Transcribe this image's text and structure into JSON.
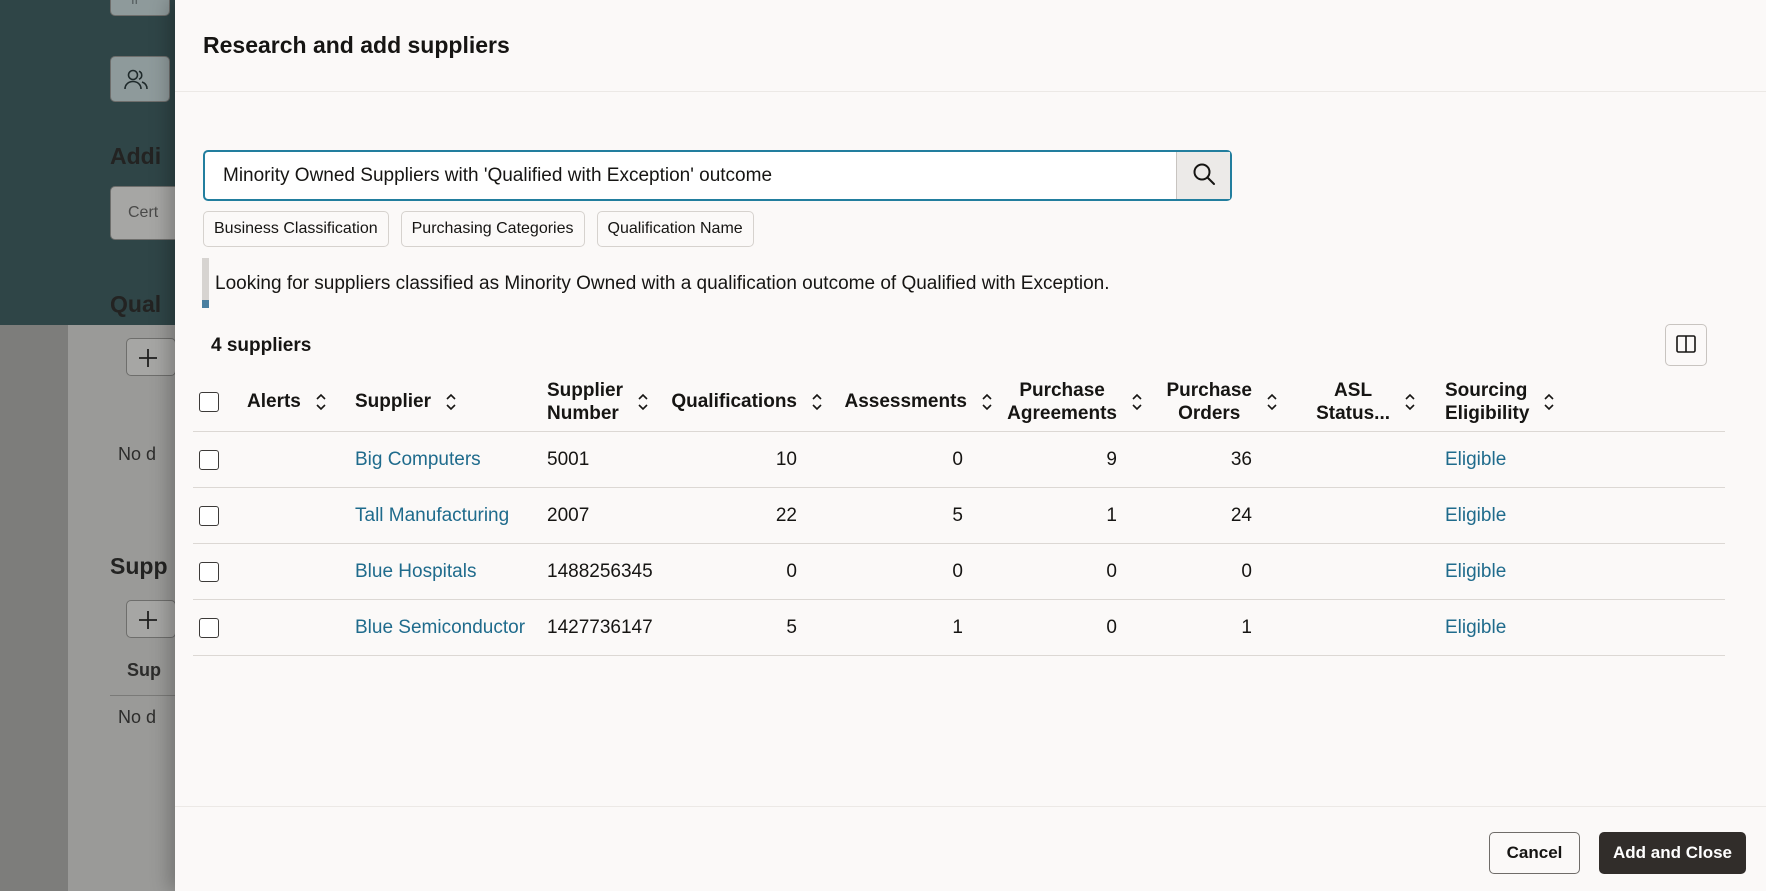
{
  "background": {
    "section_additional": "Addi",
    "field_cert": "Cert",
    "section_qual": "Qual",
    "no_data_1": "No d",
    "section_supp": "Supp",
    "col_sup": "Sup",
    "no_data_2": "No d",
    "top_btn_text": "lr"
  },
  "dialog": {
    "title": "Research and add suppliers",
    "search": {
      "value": "Minority Owned Suppliers with 'Qualified with Exception' outcome",
      "placeholder": ""
    },
    "chips": [
      {
        "label": "Business Classification"
      },
      {
        "label": "Purchasing Categories"
      },
      {
        "label": "Qualification Name"
      }
    ],
    "info_text": "Looking for suppliers classified as Minority Owned with a qualification outcome of Qualified with Exception.",
    "count_label": "4 suppliers",
    "table": {
      "columns": {
        "alerts": "Alerts",
        "supplier": "Supplier",
        "supplier_number_1": "Supplier",
        "supplier_number_2": "Number",
        "qualifications": "Qualifications",
        "assessments": "Assessments",
        "purchase_agreements_1": "Purchase",
        "purchase_agreements_2": "Agreements",
        "purchase_orders_1": "Purchase",
        "purchase_orders_2": "Orders",
        "asl_status_1": "ASL",
        "asl_status_2": "Status...",
        "sourcing_eligibility_1": "Sourcing",
        "sourcing_eligibility_2": "Eligibility"
      },
      "rows": [
        {
          "supplier": "Big Computers",
          "number": "5001",
          "qualifications": "10",
          "assessments": "0",
          "agreements": "9",
          "orders": "36",
          "asl": "",
          "eligibility": "Eligible"
        },
        {
          "supplier": "Tall Manufacturing",
          "number": "2007",
          "qualifications": "22",
          "assessments": "5",
          "agreements": "1",
          "orders": "24",
          "asl": "",
          "eligibility": "Eligible"
        },
        {
          "supplier": "Blue Hospitals",
          "number": "1488256345",
          "qualifications": "0",
          "assessments": "0",
          "agreements": "0",
          "orders": "0",
          "asl": "",
          "eligibility": "Eligible"
        },
        {
          "supplier": "Blue Semiconductor",
          "number": "1427736147",
          "qualifications": "5",
          "assessments": "1",
          "agreements": "0",
          "orders": "1",
          "asl": "",
          "eligibility": "Eligible"
        }
      ]
    },
    "footer": {
      "cancel_label": "Cancel",
      "primary_label": "Add and Close"
    }
  },
  "colors": {
    "accent_link": "#1f6b8c",
    "search_border": "#227e9e",
    "primary_button": "#312d2a",
    "background_band": "#2f4547"
  },
  "icons": [
    "search-icon",
    "sort-icon",
    "column-panel-icon",
    "users-icon",
    "plus-icon"
  ]
}
